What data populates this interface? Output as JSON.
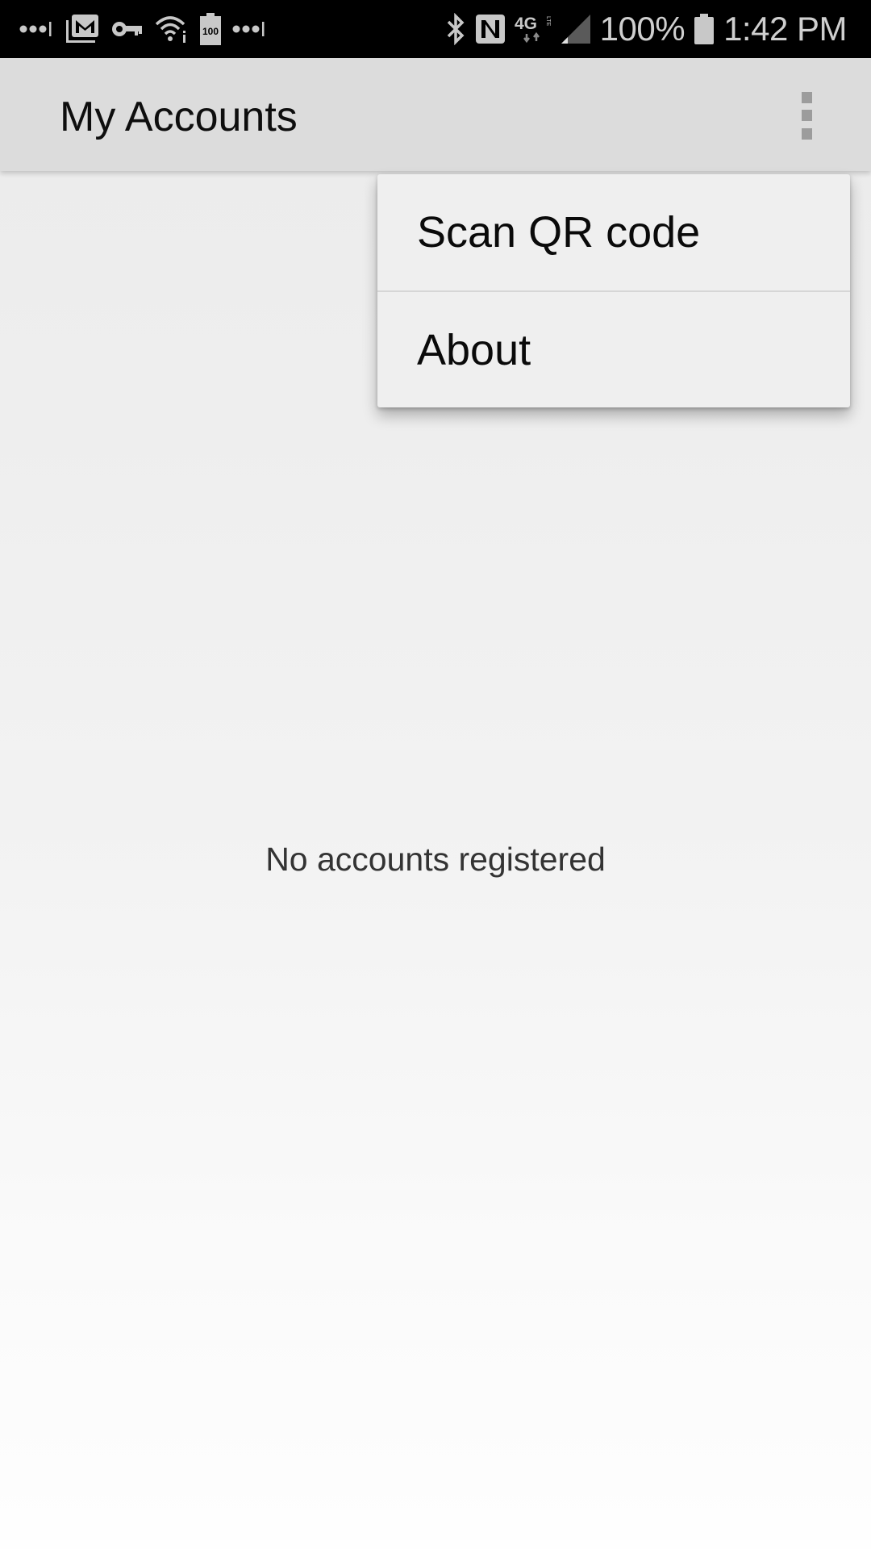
{
  "status_bar": {
    "left_icons": [
      "signal-dots-icon",
      "gmail-icon",
      "vpn-key-icon",
      "wifi-icon",
      "battery-100-icon",
      "signal-dots-icon"
    ],
    "right_icons": [
      "bluetooth-icon",
      "nfc-icon",
      "4g-lte-icon",
      "cell-signal-icon"
    ],
    "network_label": "4G",
    "network_sub": "LTE",
    "battery_percent": "100%",
    "battery_widget_label": "100",
    "time": "1:42 PM"
  },
  "app_bar": {
    "title": "My Accounts",
    "overflow_icon": "more-vert-icon"
  },
  "overflow_menu": {
    "items": [
      {
        "label": "Scan QR code"
      },
      {
        "label": "About"
      }
    ]
  },
  "main": {
    "empty_message": "No accounts registered"
  },
  "colors": {
    "status_bar_bg": "#000000",
    "app_bar_bg": "#dcdcdc",
    "menu_bg": "#efefef",
    "text_primary": "#0e0e0e",
    "empty_text": "#333333"
  }
}
